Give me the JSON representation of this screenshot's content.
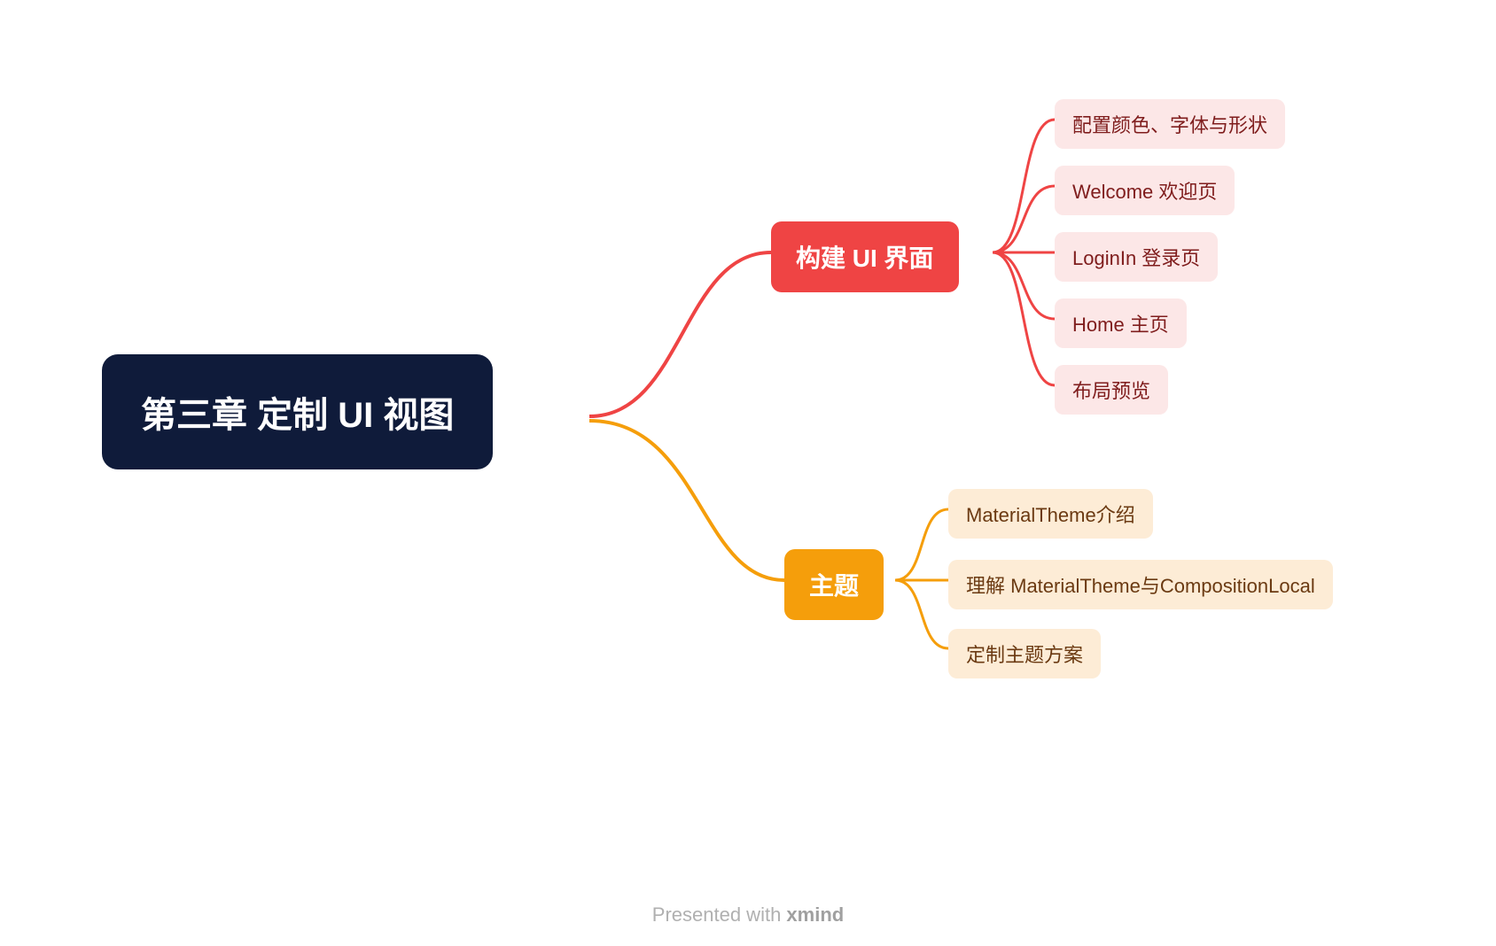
{
  "root": {
    "label": "第三章 定制 UI 视图"
  },
  "branches": [
    {
      "id": "ui",
      "label": "构建 UI 界面",
      "color": "#ef4444",
      "leaves": [
        {
          "label": "配置颜色、字体与形状"
        },
        {
          "label": "Welcome 欢迎页"
        },
        {
          "label": "LoginIn 登录页"
        },
        {
          "label": "Home 主页"
        },
        {
          "label": "布局预览"
        }
      ]
    },
    {
      "id": "theme",
      "label": "主题",
      "color": "#f59e0b",
      "leaves": [
        {
          "label": "MaterialTheme介绍"
        },
        {
          "label": "理解 MaterialTheme与CompositionLocal"
        },
        {
          "label": "定制主题方案"
        }
      ]
    }
  ],
  "footer": {
    "prefix": "Presented with ",
    "brand": "xmind"
  }
}
